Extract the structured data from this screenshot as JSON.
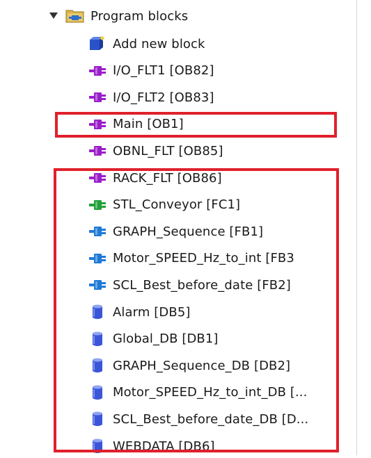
{
  "tree": {
    "parent": {
      "label": "Program blocks",
      "expanded": true,
      "icon": "folder-icon"
    },
    "items": [
      {
        "label": "Add new block",
        "icon": "add-block-icon",
        "color": "#2a52c8"
      },
      {
        "label": "I/O_FLT1 [OB82]",
        "icon": "ob-block-icon",
        "color": "#9b1fc9"
      },
      {
        "label": "I/O_FLT2 [OB83]",
        "icon": "ob-block-icon",
        "color": "#9b1fc9"
      },
      {
        "label": "Main [OB1]",
        "icon": "ob-block-icon",
        "color": "#9b1fc9"
      },
      {
        "label": "OBNL_FLT [OB85]",
        "icon": "ob-block-icon",
        "color": "#9b1fc9"
      },
      {
        "label": "RACK_FLT [OB86]",
        "icon": "ob-block-icon",
        "color": "#9b1fc9"
      },
      {
        "label": "STL_Conveyor [FC1]",
        "icon": "fc-block-icon",
        "color": "#23a038"
      },
      {
        "label": "GRAPH_Sequence [FB1]",
        "icon": "fb-block-icon",
        "color": "#1f7ad6"
      },
      {
        "label": "Motor_SPEED_Hz_to_int [FB3",
        "icon": "fb-block-icon",
        "color": "#1f7ad6"
      },
      {
        "label": "SCL_Best_before_date [FB2]",
        "icon": "fb-block-icon",
        "color": "#1f7ad6"
      },
      {
        "label": "Alarm [DB5]",
        "icon": "db-block-icon",
        "color": "#3b55d8"
      },
      {
        "label": "Global_DB [DB1]",
        "icon": "db-block-icon",
        "color": "#3b55d8"
      },
      {
        "label": "GRAPH_Sequence_DB [DB2]",
        "icon": "db-block-icon",
        "color": "#3b55d8"
      },
      {
        "label": "Motor_SPEED_Hz_to_int_DB [...",
        "icon": "db-block-icon",
        "color": "#3b55d8"
      },
      {
        "label": "SCL_Best_before_date_DB [D...",
        "icon": "db-block-icon",
        "color": "#3b55d8"
      },
      {
        "label": "WEBDATA [DB6]",
        "icon": "db-block-icon",
        "color": "#3b55d8"
      }
    ]
  },
  "highlight_color": "#e0202c"
}
